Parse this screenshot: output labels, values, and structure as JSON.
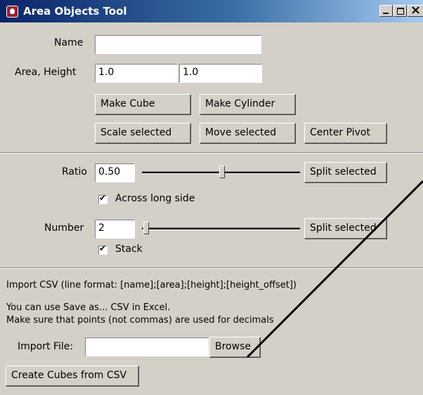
{
  "window": {
    "title": "Area Objects Tool"
  },
  "area_section": {
    "name_label": "Name",
    "name_value": "",
    "area_height_label": "Area, Height",
    "area_value": "1.0",
    "height_value": "1.0",
    "make_cube_label": "Make Cube",
    "make_cylinder_label": "Make Cylinder",
    "scale_selected_label": "Scale selected",
    "move_selected_label": "Move selected",
    "center_pivot_label": "Center Pivot"
  },
  "split_section": {
    "ratio_label": "Ratio",
    "ratio_value": "0.50",
    "ratio_slider_level": 0.5,
    "split_selected_label_1": "Split selected",
    "across_long_side_label": "Across long side",
    "across_long_side_checked": true,
    "number_label": "Number",
    "number_value": "2",
    "number_slider_level": 0.0,
    "split_selected_label_2": "Split selected",
    "stack_label": "Stack",
    "stack_checked": true
  },
  "csv_section": {
    "format_text": "Import CSV (line format: [name];[area];[height];[height_offset])",
    "help_line_1": "You can use Save as... CSV in Excel.",
    "help_line_2": "Make sure that points (not commas) are used for decimals",
    "import_file_label": "Import File:",
    "import_file_value": "",
    "browse_label": "Browse",
    "create_cubes_label": "Create Cubes from CSV"
  }
}
